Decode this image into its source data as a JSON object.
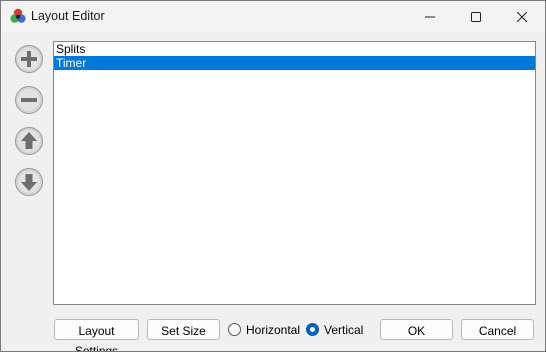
{
  "window": {
    "title": "Layout Editor",
    "controls": [
      "minimize-icon",
      "maximize-icon",
      "close-icon"
    ]
  },
  "side_buttons": [
    {
      "icon": "add-icon"
    },
    {
      "icon": "remove-icon"
    },
    {
      "icon": "move-up-icon"
    },
    {
      "icon": "move-down-icon"
    }
  ],
  "components": {
    "items": [
      "Splits",
      "Timer"
    ],
    "selected": "Timer"
  },
  "footer": {
    "layout_settings_label": "Layout Settings",
    "set_size_label": "Set Size",
    "horizontal_label": "Horizontal",
    "vertical_label": "Vertical",
    "orientation_selected": "Vertical",
    "ok_label": "OK",
    "cancel_label": "Cancel"
  },
  "colors": {
    "selection": "#0078d7",
    "radio_accent": "#005fb8"
  }
}
